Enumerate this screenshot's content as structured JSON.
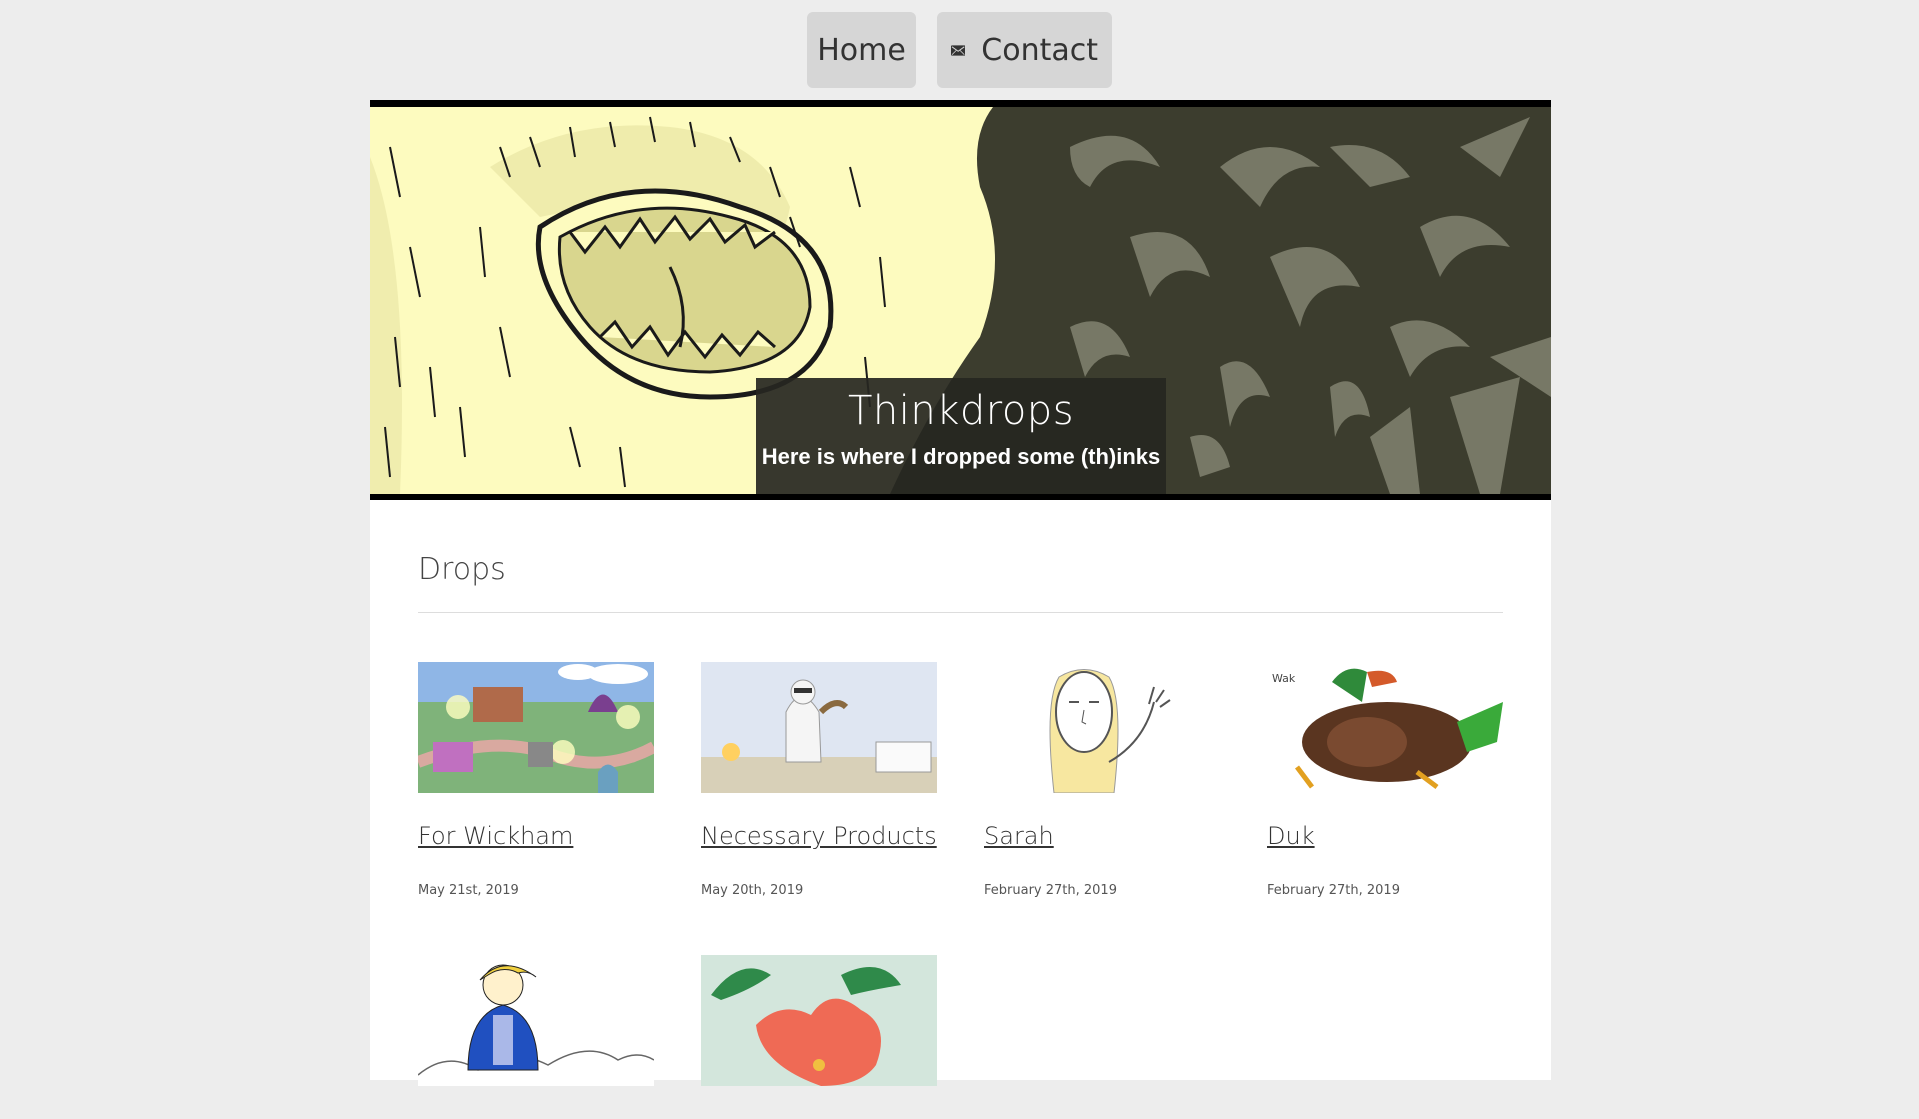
{
  "nav": {
    "home_label": "Home",
    "contact_label": "Contact",
    "contact_icon": "envelope-icon"
  },
  "hero": {
    "title": "Thinkdrops",
    "subtitle": "Here is where I dropped some (th)inks"
  },
  "section": {
    "title": "Drops"
  },
  "posts": [
    {
      "title": "For Wickham",
      "date": "May 21st, 2019"
    },
    {
      "title": "Necessary Products",
      "date": "May 20th, 2019"
    },
    {
      "title": "Sarah",
      "date": "February 27th, 2019"
    },
    {
      "title": "Duk",
      "date": "February 27th, 2019"
    },
    {
      "title": "",
      "date": ""
    },
    {
      "title": "",
      "date": ""
    }
  ],
  "colors": {
    "page_bg": "#ededed",
    "nav_button_bg": "#d6d6d6",
    "hero_yellow": "#fdfbbf",
    "hero_dark": "#3c3d2e",
    "hero_swirl": "#777866"
  }
}
